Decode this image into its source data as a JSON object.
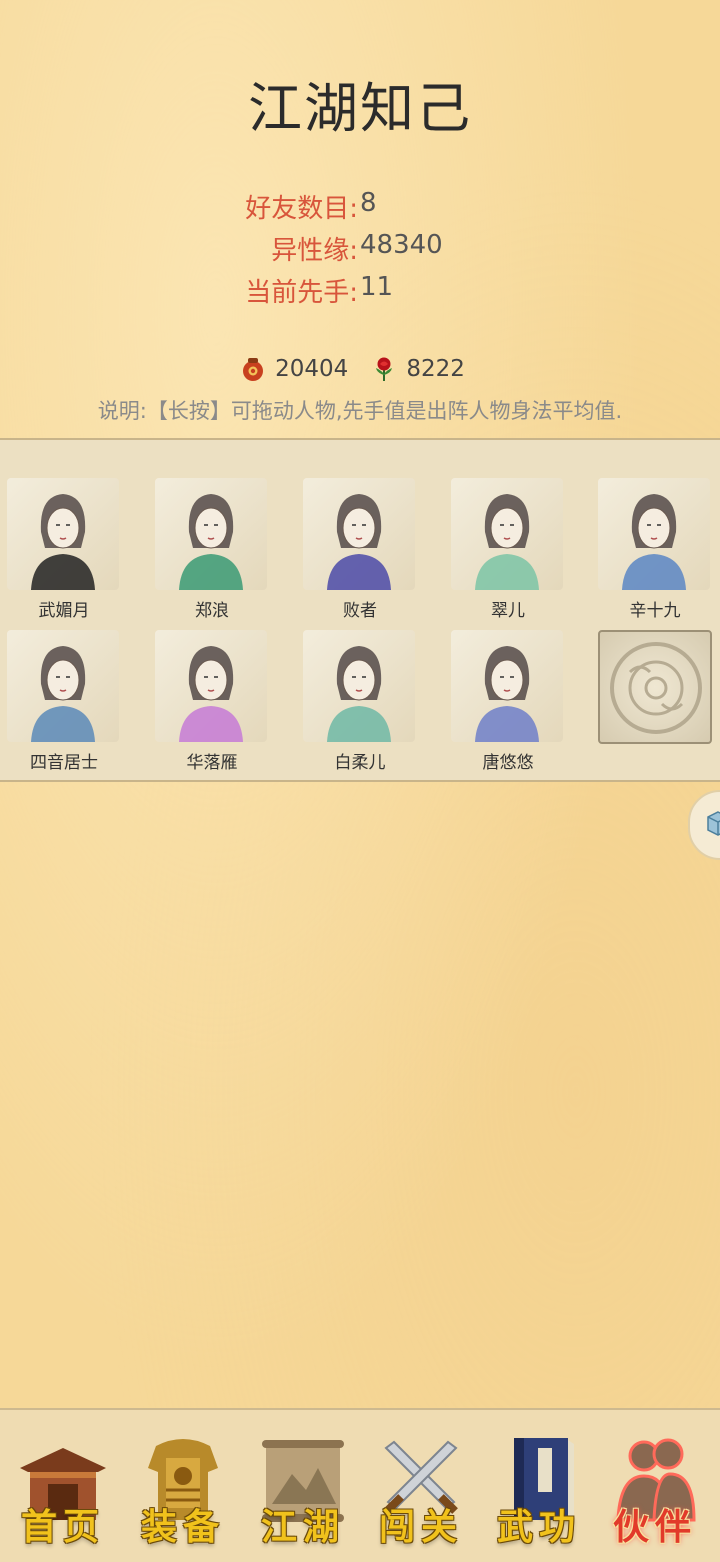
{
  "page": {
    "title": "江湖知己",
    "stats": [
      {
        "label": "好友数目:",
        "value": "8"
      },
      {
        "label": "异性缘:",
        "value": "48340"
      },
      {
        "label": "当前先手:",
        "value": "11"
      }
    ],
    "resources": [
      {
        "icon": "wine-jar-icon",
        "value": "20404"
      },
      {
        "icon": "rose-icon",
        "value": "8222"
      }
    ],
    "note": "说明:【长按】可拖动人物,先手值是出阵人物身法平均值."
  },
  "companions": [
    {
      "name": "武媚月",
      "accent": "#222222"
    },
    {
      "name": "郑浪",
      "accent": "#3a9a74"
    },
    {
      "name": "败者",
      "accent": "#4b4aa8"
    },
    {
      "name": "翠儿",
      "accent": "#7bc4a6"
    },
    {
      "name": "辛十九",
      "accent": "#5b86c4"
    },
    {
      "name": "四音居士",
      "accent": "#5a8ab8"
    },
    {
      "name": "华落雁",
      "accent": "#c67ad6"
    },
    {
      "name": "白柔儿",
      "accent": "#6fb9a6"
    },
    {
      "name": "唐悠悠",
      "accent": "#6f7fc9"
    },
    {
      "name": "",
      "accent": "#9c9076"
    }
  ],
  "nav": {
    "items": [
      {
        "label": "首页",
        "icon": "house-icon"
      },
      {
        "label": "装备",
        "icon": "armor-icon"
      },
      {
        "label": "江湖",
        "icon": "scroll-map-icon"
      },
      {
        "label": "闯关",
        "icon": "crossed-swords-icon"
      },
      {
        "label": "武功",
        "icon": "book-icon"
      },
      {
        "label": "伙伴",
        "icon": "companions-icon"
      }
    ],
    "active": "伙伴"
  },
  "colors": {
    "background": "#f6d898",
    "stat_label": "#d8553b",
    "nav_label": "#f1c21c",
    "nav_active": "#e23a2a"
  }
}
